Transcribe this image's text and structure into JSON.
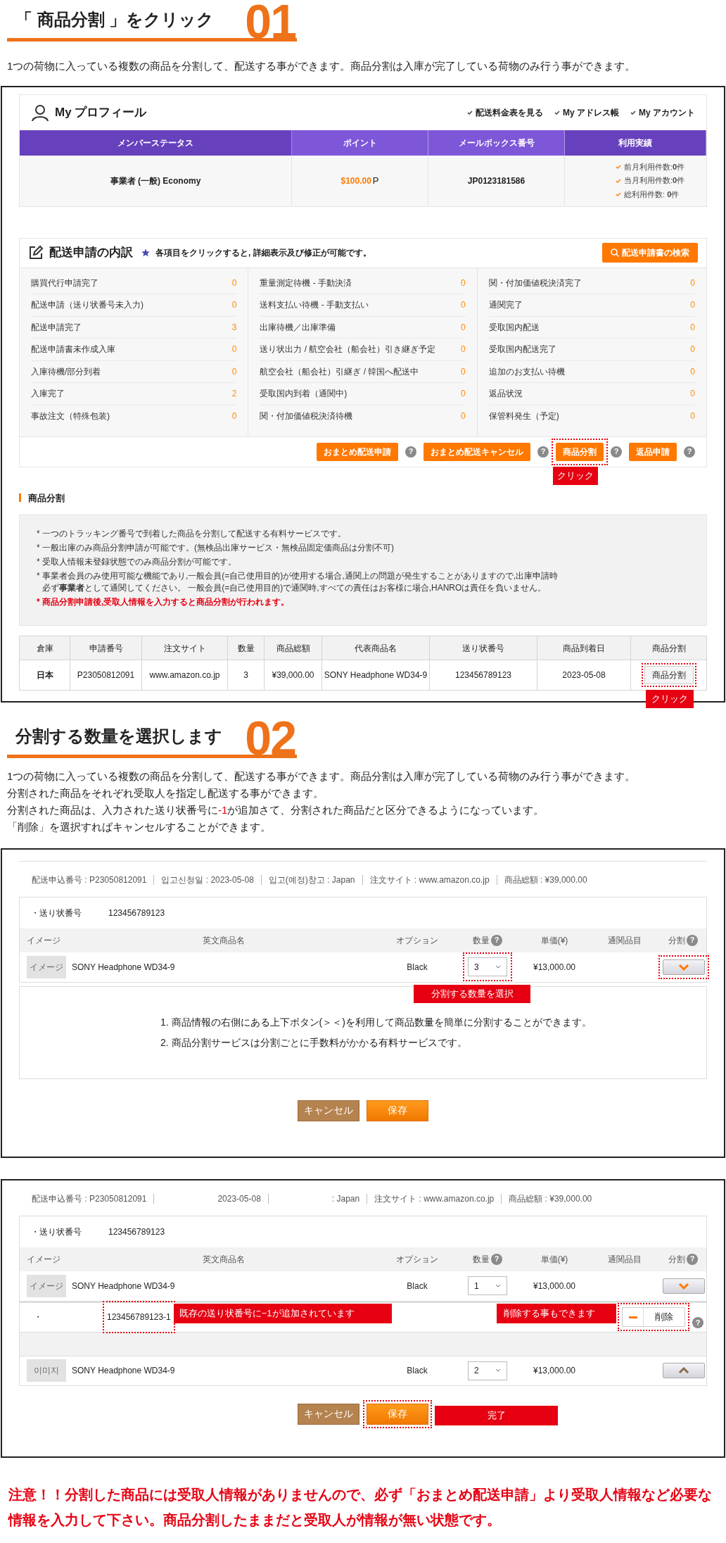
{
  "step1": {
    "title": "「 商品分割 」をクリック",
    "number": "01",
    "description": "1つの荷物に入っている複数の商品を分割して、配送する事ができます。商品分割は入庫が完了している荷物のみ行う事ができます。"
  },
  "profile": {
    "title": "My プロフィール",
    "links": [
      "配送料金表を見る",
      "My アドレス帳",
      "My アカウント"
    ],
    "columns": [
      "メンバーステータス",
      "ポイント",
      "メールボックス番号",
      "利用実績"
    ],
    "status": "事業者 (一般) Economy",
    "points_value": "$100.00",
    "points_unit": "P",
    "mailbox": "JP0123181586",
    "usage": [
      "前月利用件数:**0**件",
      "当月利用件数:**0**件",
      "総利用件数: **0**件"
    ]
  },
  "shipments": {
    "title": "配送申請の内訳",
    "hint": "各項目をクリックすると, 詳細表示及び修正が可能です。",
    "search_button": "配送申請書の検索",
    "columns": [
      [
        {
          "label": "購買代行申請完了",
          "count": "0"
        },
        {
          "label": "配送申請（送り状番号未入力)",
          "count": "0"
        },
        {
          "label": "配送申請完了",
          "count": "3"
        },
        {
          "label": "配送申請書未作成入庫",
          "count": "0"
        },
        {
          "label": "入庫待機/部分到着",
          "count": "0"
        },
        {
          "label": "入庫完了",
          "count": "2"
        },
        {
          "label": "事故注文（特殊包装)",
          "count": "0"
        }
      ],
      [
        {
          "label": "重量測定待機 - 手動決済",
          "count": "0"
        },
        {
          "label": "送料支払い待機 - 手動支払い",
          "count": "0"
        },
        {
          "label": "出庫待機／出庫準備",
          "count": "0"
        },
        {
          "label": "送り状出力 / 航空会社（船会社）引き継ぎ予定",
          "count": "0"
        },
        {
          "label": "航空会社（船会社）引継ぎ / 韓国へ配送中",
          "count": "0"
        },
        {
          "label": "受取国内到着（通関中)",
          "count": "0"
        },
        {
          "label": "関・付加価値税決済待機",
          "count": "0"
        }
      ],
      [
        {
          "label": "関・付加価値税決済完了",
          "count": "0"
        },
        {
          "label": "通関完了",
          "count": "0"
        },
        {
          "label": "受取国内配送",
          "count": "0"
        },
        {
          "label": "受取国内配送完了",
          "count": "0"
        },
        {
          "label": "追加のお支払い待機",
          "count": "0"
        },
        {
          "label": "返品状況",
          "count": "0"
        },
        {
          "label": "保管料発生（予定)",
          "count": "0"
        }
      ]
    ],
    "buttons": [
      {
        "label": "おまとめ配送申請",
        "help": "?",
        "highlighted": false
      },
      {
        "label": "おまとめ配送キャンセル",
        "help": "?",
        "highlighted": false
      },
      {
        "label": "商品分割",
        "help": "?",
        "highlighted": true,
        "callout": "クリック"
      },
      {
        "label": "返品申請",
        "help": "?",
        "highlighted": false
      }
    ]
  },
  "split_section": {
    "title": "商品分割",
    "notes": [
      {
        "kind": "normal",
        "lines": [
          "* 一つのトラッキング番号で到着した商品を分割して配送する有料サービスです。"
        ]
      },
      {
        "kind": "normal",
        "lines": [
          "* 一般出庫のみ商品分割申請が可能です。(無検品出庫サービス・無検品固定価商品は分割不可)"
        ]
      },
      {
        "kind": "normal",
        "lines": [
          "* 受取人情報未登録状態でのみ商品分割が可能です。"
        ]
      },
      {
        "kind": "normal",
        "lines": [
          "* 事業者会員のみ使用可能な機能であり,一般会員(=自己使用目的)が使用する場合,通関上の問題が発生することがありますので,出庫申請時",
          "必ず**事業者**として通関してください。 一般会員(=自己使用目的)で通関時,すべての責任はお客様に場合,HANROは責任を負いません。"
        ]
      },
      {
        "kind": "alert",
        "lines": [
          "* 商品分割申請後,**受取人情報**を入力すると商品分割が行われます。"
        ]
      }
    ],
    "table": {
      "columns": [
        "倉庫",
        "申請番号",
        "注文サイト",
        "数量",
        "商品総額",
        "代表商品名",
        "送り状番号",
        "商品到着日",
        "商品分割"
      ],
      "row": [
        "日本",
        "P23050812091",
        "www.amazon.co.jp",
        "3",
        "¥39,000.00",
        "SONY Headphone WD34-9",
        "123456789123",
        "2023-05-08"
      ],
      "action": "商品分割",
      "callout": "クリック"
    }
  },
  "step2": {
    "title": "分割する数量を選択します",
    "number": "02",
    "description": [
      [
        {
          "text": "1つの荷物に入っている複数の商品を分割して、配送する事ができます。商品分割は入庫が完了している荷物のみ行う事ができます。",
          "highlight": false
        }
      ],
      [
        {
          "text": "分割された商品をそれぞれ受取人を指定し配送する事ができます。",
          "highlight": false
        }
      ],
      [
        {
          "text": "分割された商品は、入力された送り状番号に",
          "highlight": false
        },
        {
          "text": "-1",
          "highlight": true
        },
        {
          "text": "が追加さて、分割された商品だと区分できるようになっています。",
          "highlight": false
        }
      ],
      [
        {
          "text": "「削除」を選択すればキャンセルすることができます。",
          "highlight": false
        }
      ]
    ]
  },
  "forms": [
    {
      "meta": [
        "配送申込番号 : P23050812091",
        "입고신청일 : 2023-05-08",
        "입고(예정)창고 : Japan",
        "注文サイト : www.amazon.co.jp",
        "商品総額 : ¥39,000.00"
      ],
      "tracking_label": "・送り状番号",
      "tracking": "123456789123",
      "columns": [
        {
          "label": "イメージ"
        },
        {
          "label": "英文商品名"
        },
        {
          "label": "オプション"
        },
        {
          "label": "数量",
          "help": "?"
        },
        {
          "label": "単価(¥)"
        },
        {
          "label": "通関品目"
        },
        {
          "label": "分割",
          "help": "?"
        }
      ],
      "rows": [
        {
          "kind": "item",
          "image_label": "イメージ",
          "name": "SONY Headphone WD34-9",
          "option": "Black",
          "qty": "3",
          "price": "¥13,000.00",
          "arrow_up": false,
          "qty_highlighted": true,
          "arrow_highlighted": true,
          "callout": "分割する数量を選択"
        }
      ],
      "info": [
        "1. 商品情報の右側にある上下ボタン(＞＜)を利用して商品数量を簡単に分割することができます。",
        "2. 商品分割サービスは分割ごとに手数料がかかる有料サービスです。"
      ],
      "buttons": [
        {
          "label": "キャンセル",
          "kind": "cancel",
          "highlighted": false
        },
        {
          "label": "保存",
          "kind": "save",
          "highlighted": false
        }
      ]
    },
    {
      "meta": [
        "配送申込番号 : P23050812091",
        "2023-05-08",
        ": Japan",
        "注文サイト : www.amazon.co.jp",
        "商品総額 : ¥39,000.00"
      ],
      "tracking_label": "・送り状番号",
      "tracking": "123456789123",
      "columns": [
        {
          "label": "イメージ"
        },
        {
          "label": "英文商品名"
        },
        {
          "label": "オプション"
        },
        {
          "label": "数量",
          "help": "?"
        },
        {
          "label": "単価(¥)"
        },
        {
          "label": "通関品目"
        },
        {
          "label": "分割",
          "help": "?"
        }
      ],
      "rows": [
        {
          "kind": "item",
          "image_label": "イメージ",
          "name": "SONY Headphone WD34-9",
          "option": "Black",
          "qty": "1",
          "price": "¥13,000.00",
          "arrow_up": false,
          "qty_highlighted": false,
          "arrow_highlighted": false
        },
        {
          "kind": "split",
          "bullet": "・",
          "tracking": "123456789123-1",
          "tracking_callout": "既存の送り状番号に−1が追加されています",
          "delete_callout": "削除する事もできます",
          "delete_label": "削除",
          "help": "?"
        },
        {
          "kind": "blank"
        },
        {
          "kind": "item",
          "image_label": "이미지",
          "name": "SONY Headphone WD34-9",
          "option": "Black",
          "qty": "2",
          "price": "¥13,000.00",
          "arrow_up": true,
          "qty_highlighted": false,
          "arrow_highlighted": false
        }
      ],
      "buttons": [
        {
          "label": "キャンセル",
          "kind": "cancel",
          "highlighted": false
        },
        {
          "label": "保存",
          "kind": "save",
          "highlighted": true,
          "callout": "完了"
        }
      ]
    }
  ],
  "warning": "注意！！分割した商品には受取人情報がありませんので、必ず「おまとめ配送申請」より受取人情報など必要な情報を入力して下さい。商品分割したままだと受取人が情報が無い状態です。"
}
